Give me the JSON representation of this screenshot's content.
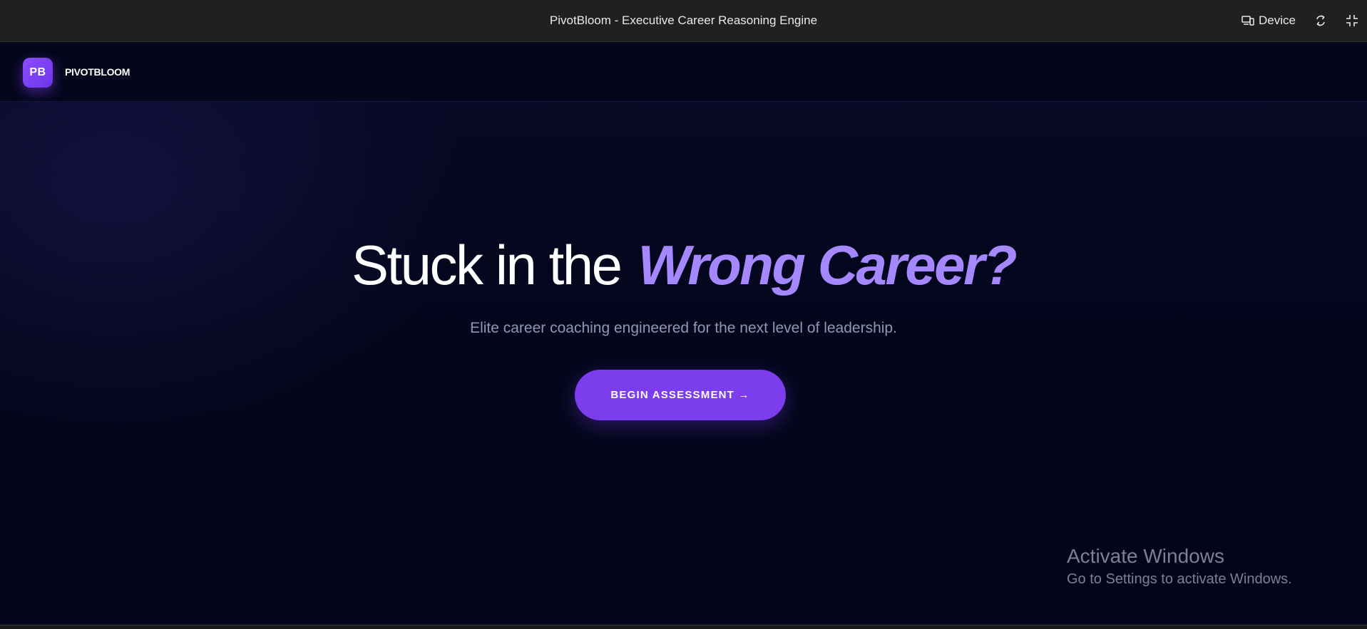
{
  "window": {
    "title": "PivotBloom - Executive Career Reasoning Engine",
    "controls": {
      "device_label": "Device",
      "device_icon": "device-icon",
      "refresh_icon": "refresh-icon",
      "fullscreen_icon": "exit-fullscreen-icon"
    }
  },
  "navbar": {
    "logo_mark": "PB",
    "logo_text": "PIVOTBLOOM"
  },
  "hero": {
    "headline_plain": "Stuck in the",
    "headline_accent": "Wrong Career?",
    "subhead": "Elite career coaching engineered for the next level of leadership.",
    "cta_label": "BEGIN ASSESSMENT →"
  },
  "watermark": {
    "title": "Activate Windows",
    "subtitle": "Go to Settings to activate Windows."
  },
  "colors": {
    "accent": "#7c3ded",
    "accent_text": "#a587ff",
    "background": "#04061a",
    "titlebar": "#202020"
  }
}
